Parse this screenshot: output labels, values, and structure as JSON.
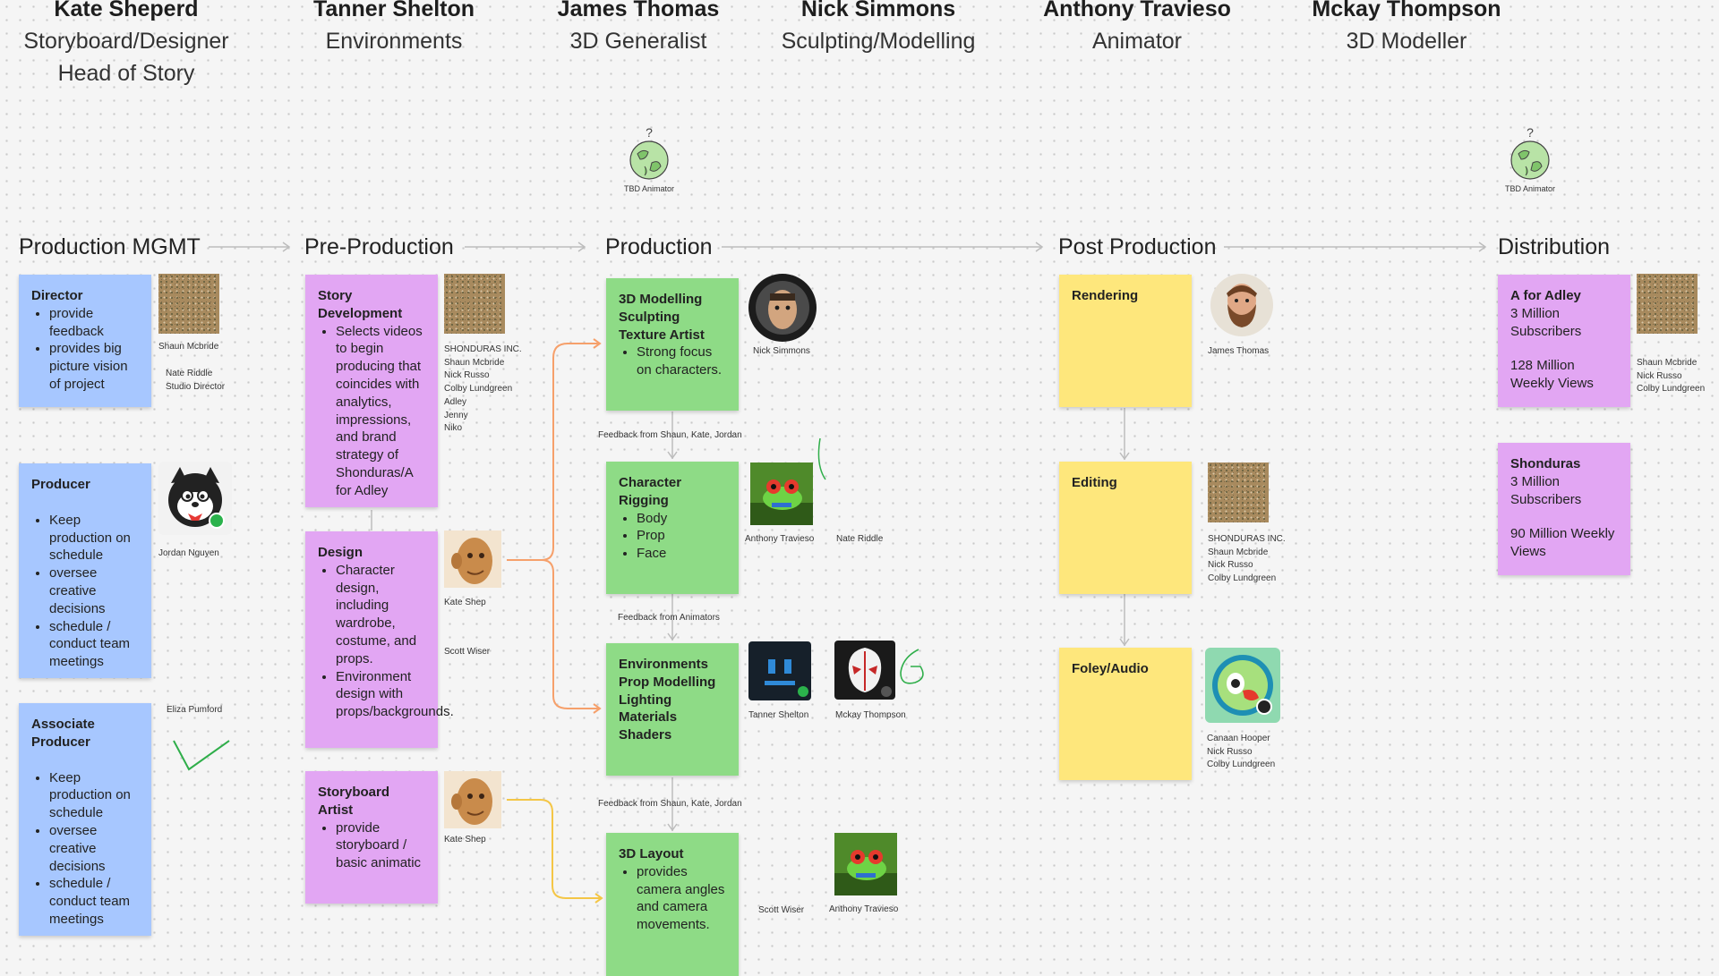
{
  "team": [
    {
      "name": "Kate Sheperd",
      "role": "Storyboard/Designer",
      "role2": "Head of Story"
    },
    {
      "name": "Tanner Shelton",
      "role": "Environments"
    },
    {
      "name": "James Thomas",
      "role": "3D Generalist"
    },
    {
      "name": "Nick Simmons",
      "role": "Sculpting/Modelling"
    },
    {
      "name": "Anthony Travieso",
      "role": "Animator"
    },
    {
      "name": "Mckay Thompson",
      "role": "3D Modeller"
    }
  ],
  "tbd": [
    {
      "question": "?",
      "label": "TBD Animator"
    },
    {
      "question": "?",
      "label": "TBD Animator"
    }
  ],
  "stages": [
    "Production MGMT",
    "Pre-Production",
    "Production",
    "Post Production",
    "Distribution"
  ],
  "mgmt": {
    "director": {
      "title": "Director",
      "items": [
        "provide feedback",
        "provides big picture vision of project"
      ],
      "people": [
        "Shaun Mcbride",
        "Nate Riddle",
        "Studio Director"
      ]
    },
    "producer": {
      "title": "Producer",
      "items": [
        "Keep production on schedule",
        "oversee creative decisions",
        "schedule / conduct team meetings"
      ],
      "people": [
        "Jordan Nguyen"
      ]
    },
    "associate": {
      "title": "Associate Producer",
      "items": [
        "Keep production on schedule",
        "oversee creative decisions",
        "schedule / conduct team meetings"
      ],
      "people": [
        "Eliza Pumford"
      ]
    }
  },
  "pre": {
    "story": {
      "title": "Story Development",
      "items": [
        "Selects videos to begin producing that coincides with analytics, impressions, and brand strategy of Shonduras/A for Adley"
      ],
      "people": [
        "SHONDURAS INC.",
        "Shaun Mcbride",
        "Nick Russo",
        "Colby Lundgreen",
        "Adley",
        "Jenny",
        "Niko"
      ]
    },
    "design": {
      "title": "Design",
      "items": [
        "Character design, including wardrobe, costume, and props.",
        "Environment design with props/backgrounds."
      ],
      "people": [
        "Kate Shep",
        "Scott Wiser"
      ]
    },
    "storyboard": {
      "title": "Storyboard Artist",
      "items": [
        "provide storyboard / basic animatic"
      ],
      "people": [
        "Kate Shep"
      ]
    }
  },
  "prod": {
    "modelling": {
      "title": "3D Modelling Sculpting Texture Artist",
      "items": [
        "Strong focus on characters."
      ],
      "people": [
        "Nick Simmons"
      ]
    },
    "feedback1": "Feedback from Shaun, Kate, Jordan",
    "rigging": {
      "title": "Character Rigging",
      "items": [
        "Body",
        "Prop",
        "Face"
      ],
      "people": [
        "Anthony Travieso",
        "Nate Riddle"
      ]
    },
    "feedback2": "Feedback from Animators",
    "environments": {
      "title": "Environments Prop Modelling Lighting Materials Shaders",
      "people": [
        "Tanner Shelton",
        "Mckay Thompson"
      ]
    },
    "feedback3": "Feedback from Shaun, Kate, Jordan",
    "layout": {
      "title": "3D Layout",
      "items": [
        "provides camera angles and camera movements."
      ],
      "people": [
        "Scott Wiser",
        "Anthony Travieso"
      ]
    }
  },
  "post": {
    "rendering": {
      "title": "Rendering",
      "people": [
        "James Thomas"
      ]
    },
    "editing": {
      "title": "Editing",
      "people": [
        "SHONDURAS INC.",
        "Shaun Mcbride",
        "Nick Russo",
        "Colby Lundgreen"
      ]
    },
    "foley": {
      "title": "Foley/Audio",
      "people": [
        "Canaan Hooper",
        "Nick Russo",
        "Colby Lundgreen"
      ]
    }
  },
  "dist": {
    "adley": {
      "title": "A for Adley",
      "subs": "3 Million Subscribers",
      "views": "128 Million Weekly Views",
      "people": [
        "Shaun Mcbride",
        "Nick Russo",
        "Colby Lundgreen"
      ]
    },
    "shonduras": {
      "title": "Shonduras",
      "subs": "3 Million Subscribers",
      "views": "90 Million Weekly Views"
    }
  },
  "colors": {
    "blue": "#a7c7ff",
    "purple": "#e2a6f3",
    "green": "#8edb86",
    "yellow": "#fee77c",
    "connector_orange": "#f6a06b",
    "connector_yellow": "#f4c646",
    "connector_gray": "#bdbdbd",
    "check_green": "#2fae4a"
  },
  "icons": [
    "tbd-globe-icon",
    "checkmark-icon",
    "squiggle-icon",
    "frog-avatar",
    "cat-avatar",
    "cube-avatar",
    "mask-avatar",
    "parrot-avatar",
    "clay-head-avatar",
    "astronaut-avatar",
    "bearded-man-avatar"
  ]
}
